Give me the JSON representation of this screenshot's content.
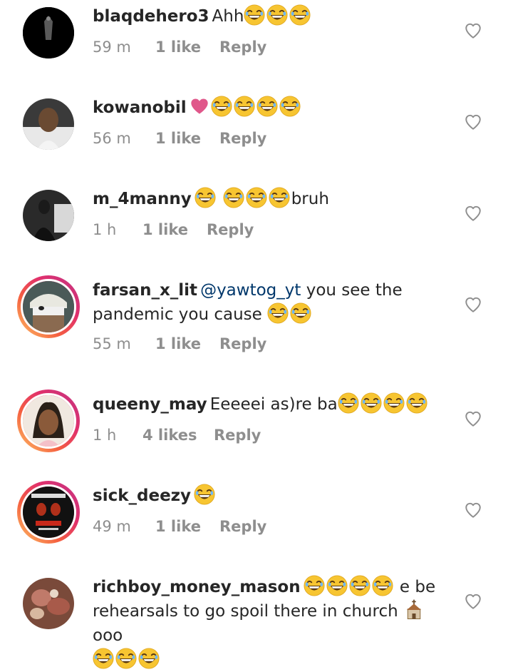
{
  "comments": [
    {
      "username": "blaqdehero3",
      "text": "Ahh",
      "emoji_after": 3,
      "time": "59 m",
      "likes": "1 like",
      "reply": "Reply"
    },
    {
      "username": "kowanobil",
      "text": "",
      "emoji_after": 4,
      "heart_emoji": true,
      "time": "56 m",
      "likes": "1 like",
      "reply": "Reply"
    },
    {
      "username": "m_4manny",
      "text": "bruh",
      "emoji_after": 4,
      "time": "1 h",
      "likes": "1 like",
      "reply": "Reply"
    },
    {
      "username": "farsan_x_lit",
      "mention": "@yawtog_yt",
      "text_line1": "you see the",
      "text_line2": "pandemic you cause",
      "time": "55 m",
      "likes": "1 like",
      "reply": "Reply"
    },
    {
      "username": "queeny_may",
      "text": "Eeeeei as)re ba",
      "time": "1 h",
      "likes": "4 likes",
      "reply": "Reply"
    },
    {
      "username": "sick_deezy",
      "text": "",
      "time": "49 m",
      "likes": "1 like",
      "reply": "Reply"
    },
    {
      "username": "richboy_money_mason",
      "text_line1": "e be",
      "text_line2": "rehearsals to go spoil there in church",
      "text_line2b": "ooo"
    }
  ],
  "colors": {
    "text": "#262626",
    "meta": "#8e8e8e",
    "mention": "#00376b",
    "heart_outline": "#8e8e8e",
    "story_ring": "#e1306c"
  },
  "icons": {
    "like": "heart-outline-icon",
    "emoji": "laughing-emoji-icon"
  }
}
